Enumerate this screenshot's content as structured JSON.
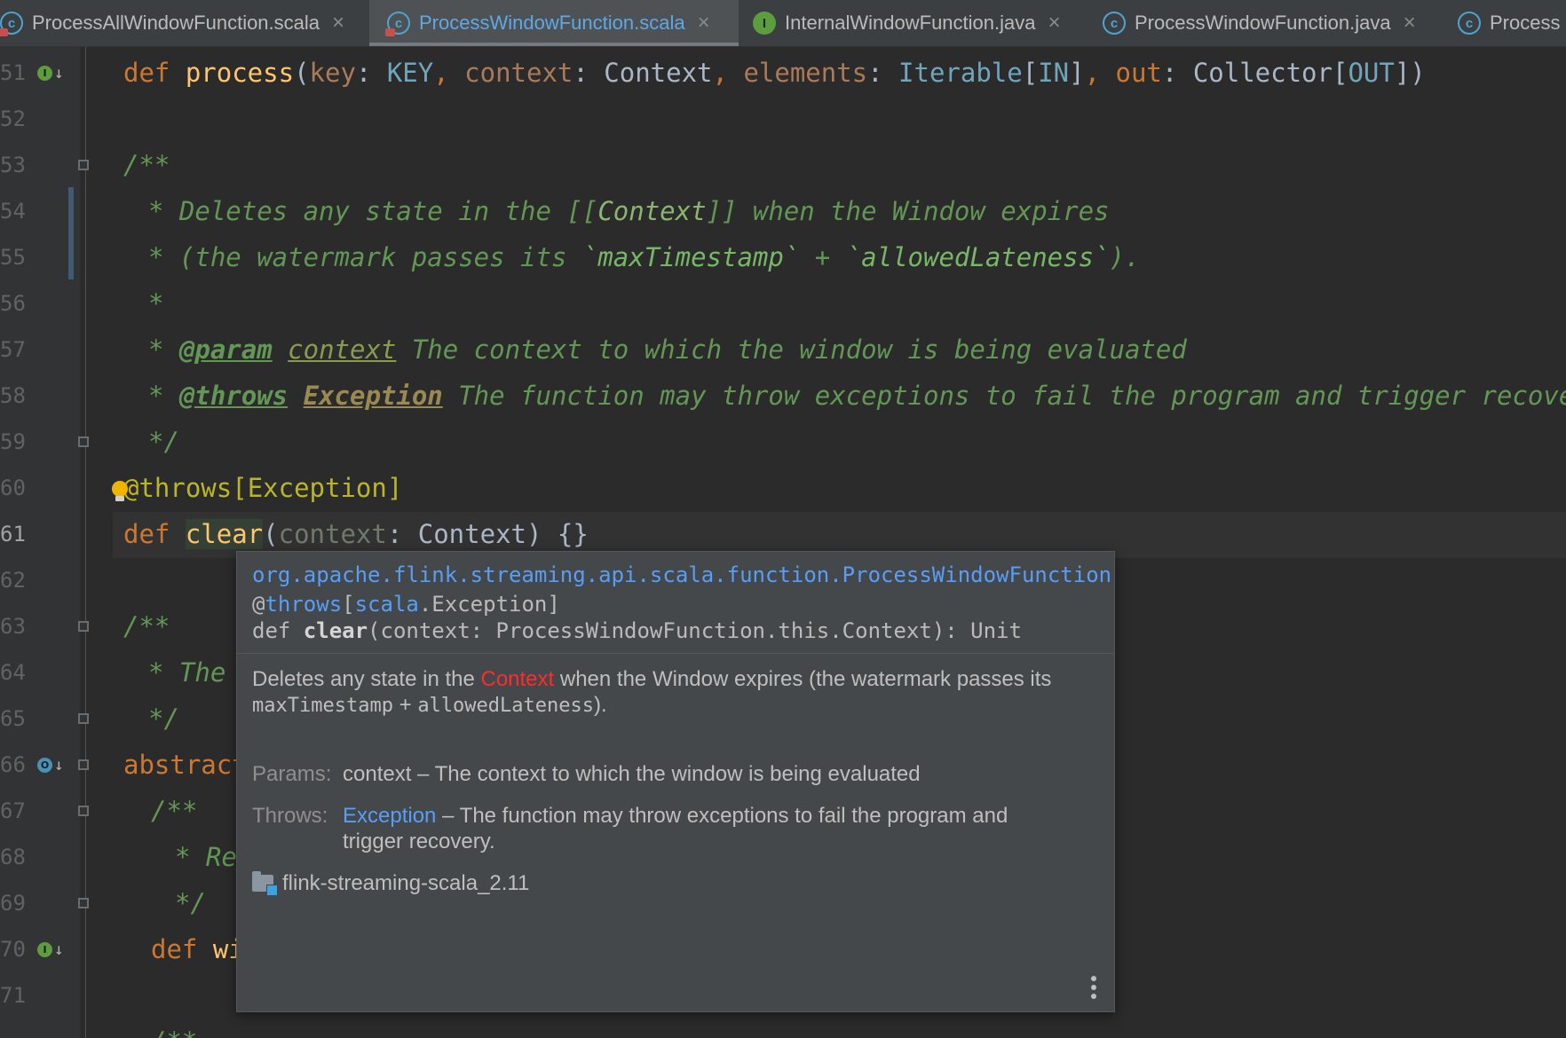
{
  "tabs": [
    {
      "label": "ProcessAllWindowFunction.scala",
      "icon": "scala-class-icon"
    },
    {
      "label": "ProcessWindowFunction.scala",
      "icon": "scala-class-icon",
      "active": true
    },
    {
      "label": "InternalWindowFunction.java",
      "icon": "interface-icon"
    },
    {
      "label": "ProcessWindowFunction.java",
      "icon": "java-class-icon"
    },
    {
      "label": "Process",
      "icon": "java-class-icon"
    }
  ],
  "gutter": {
    "line_numbers": [
      "51",
      "52",
      "53",
      "54",
      "55",
      "56",
      "57",
      "58",
      "59",
      "60",
      "61",
      "62",
      "63",
      "64",
      "65",
      "66",
      "67",
      "68",
      "69",
      "70",
      "71"
    ]
  },
  "code": {
    "l51": {
      "def": "def ",
      "name": "process",
      "p1": "key",
      "t1": "KEY",
      "p2": "context",
      "t2": "Context",
      "p3": "elements",
      "t3a": "Iterable",
      "t3b": "IN",
      "p4": "out",
      "t4a": "Collector",
      "t4b": "OUT"
    },
    "l53": "/**",
    "l54": {
      "a": "* Deletes any state in the [[",
      "b": "Context",
      "c": "]] when the Window expires"
    },
    "l55": {
      "a": "* (the watermark passes its ",
      "b": "`maxTimestamp`",
      "c": " + ",
      "d": "`allowedLateness`",
      "e": ")."
    },
    "l56": "*",
    "l57": {
      "star": "* ",
      "tag": "@param",
      "ref": "context",
      "text": " The context to which the window is being evaluated"
    },
    "l58": {
      "star": "* ",
      "tag": "@throws",
      "ref": "Exception",
      "text": " The function may throw exceptions to fail the program and trigger recovery."
    },
    "l59": "*/",
    "l60": {
      "ann": "@throws",
      "br1": "[",
      "exc": "Exception",
      "br2": "]"
    },
    "l61": {
      "def": "def ",
      "name": "clear",
      "p": "context",
      "t": "Context",
      "body": "{}"
    },
    "l63": "/**",
    "l64": "* The",
    "l65": "*/",
    "l66": "abstract",
    "l67": "/**",
    "l68": "* Re",
    "l69": "*/",
    "l70": {
      "def": "def ",
      "name": "wi"
    },
    "l72": "/**"
  },
  "popup": {
    "fqcn": "org.apache.flink.streaming.api.scala.function.ProcessWindowFunction",
    "annotation_at": "@",
    "annotation_name": "throws",
    "annotation_scala": "scala",
    "annotation_rest": ".Exception]",
    "signature_def": "def ",
    "signature_name": "clear",
    "signature_rest": "(context: ProcessWindowFunction.this.Context): Unit",
    "desc_1": "Deletes any state in the ",
    "desc_ctx": "Context",
    "desc_2": " when the Window expires (the watermark passes its ",
    "desc_code1": "maxTimestamp",
    "desc_plus": " + ",
    "desc_code2": "allowedLateness",
    "desc_3": ").",
    "params_label": "Params:",
    "params_text": "context – The context to which the window is being evaluated",
    "throws_label": "Throws:",
    "throws_link": "Exception",
    "throws_text": " – The function may throw exceptions to fail the program and trigger recovery.",
    "library": "flink-streaming-scala_2.11"
  },
  "colors": {
    "background": "#2b2b2b",
    "keyword": "#cc7832",
    "function": "#ffc66d",
    "doc_comment": "#629755",
    "annotation": "#bbb529",
    "link": "#589df6"
  }
}
